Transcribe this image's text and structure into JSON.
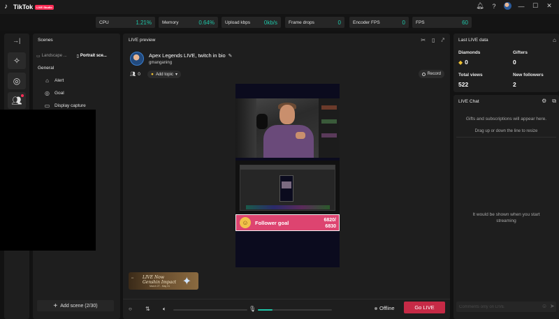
{
  "app": {
    "name": "TikTok",
    "badge": "LIVE Studio"
  },
  "stats": [
    {
      "label": "CPU",
      "value": "1.21%"
    },
    {
      "label": "Memory",
      "value": "0.64%"
    },
    {
      "label": "Upload kbps",
      "value": "0kb/s"
    },
    {
      "label": "Frame drops",
      "value": "0"
    },
    {
      "label": "Encoder FPS",
      "value": "0"
    },
    {
      "label": "FPS",
      "value": "60"
    }
  ],
  "scenes": {
    "title": "Scenes",
    "tabs": [
      "Landscape ...",
      "Portrait sce..."
    ],
    "group": "General",
    "sources": [
      "Alert",
      "Goal",
      "Display capture"
    ],
    "add_label": "Add scene (2/30)"
  },
  "preview": {
    "title": "LIVE preview",
    "stream_title": "Apex Legends LIVE, twitch in bio",
    "username": "gmanganing",
    "viewers": "0",
    "add_topic": "Add topic",
    "record": "Record",
    "goal_label": "Follower goal",
    "goal_value": "6820/\n6830",
    "banner_title": "LIVE Now\nGenshin Impact",
    "banner_sub": "March 27 - May 31",
    "status": "Offline",
    "go_live": "Go LIVE",
    "mic_level": 0.2
  },
  "last_live": {
    "title": "Last LIVE data",
    "diamonds_label": "Diamonds",
    "diamonds": "0",
    "gifters_label": "Gifters",
    "gifters": "0",
    "views_label": "Total views",
    "views": "522",
    "followers_label": "New followers",
    "followers": "2"
  },
  "chat": {
    "title": "LIVE Chat",
    "gifts_note": "Gifts and subscriptions will appear here.",
    "drag_note": "Drag up or down the line to resize",
    "empty_note": "It would be shown when you start streaming",
    "placeholder": "Comments only on LIVE"
  },
  "colors": {
    "accent": "#1ec6a8",
    "brand": "#fe2c55",
    "go_live": "#c62a46",
    "goal": "#dd4470"
  }
}
